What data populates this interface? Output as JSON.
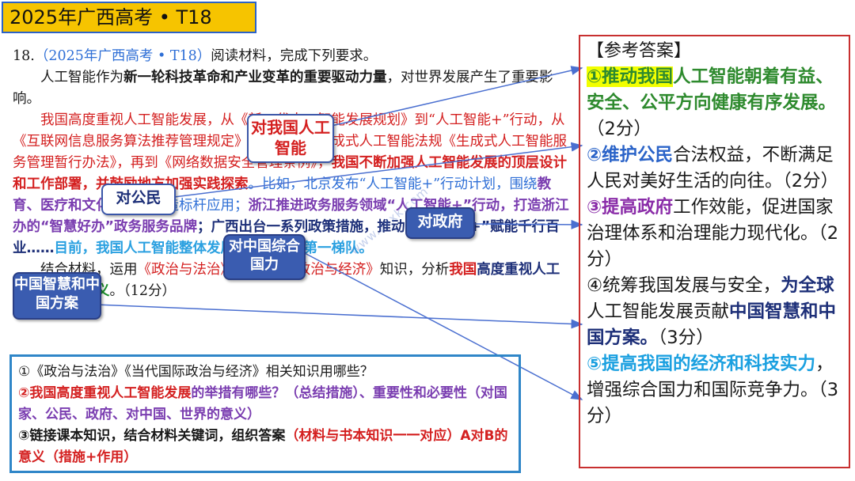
{
  "header": {
    "title": "2025年广西高考 • T18"
  },
  "material": {
    "q_number": "18.",
    "q_source": "（2025年广西高考 • T18）",
    "q_intro": "阅读材料，完成下列要求。",
    "p1_a": "人工智能作为",
    "p1_b": "新一轮科技革命和产业变革的重要驱动力量",
    "p1_c": "，对世界发展产生了重要影响。",
    "p2_a": "我国高度重视人工智能发展，从《新一代人工智能发展规划》到“人工智能+”行动，从《互联网信息服务算法推荐管理规定》到全球首部生成式人工智能法规《生成式人工智能服务管理暂行办法》，再到《网络数据安全管理条例》，",
    "p2_b": "我国不断加强人工智能发展的顶层设计和工作部署，并鼓励地方加强实践探索",
    "p2_c": "。比如，北京发布“人工智能+”行动计划，围绕",
    "p2_d": "教育、医疗和文化",
    "p2_e": "等领域打造标杆应用；",
    "p2_f": "浙江推进政务服务领域“人工智能+”行动，打造浙江办的“智慧好办”政务服务品牌",
    "p2_g": "；广西出台一系列政策措施，推动“人工智能+”赋能千行百业……",
    "p2_h": "目前，我国人工智能整体发展已进入全球第一梯队。",
    "p3_a": "结合材料，运用",
    "p3_b": "《政治与法治》《当代国际政治与经济》",
    "p3_c": "知识，分析",
    "p3_d": "我国",
    "p3_e": "高度重视人工智能发展",
    "p3_f": "的",
    "p3_g": "意义",
    "p3_h": "。（12分）"
  },
  "callouts": {
    "ai": "对我国人工智能",
    "citizen": "对公民",
    "government": "对政府",
    "national_power": "对中国综合国力",
    "china_wisdom": "中国智慧和中国方案"
  },
  "question_box": {
    "l1": "①《政治与法治》《当代国际政治与经济》相关知识用哪些？",
    "l2_a": "②我国高度重视人工智能发展",
    "l2_b": "的举措有哪些？（总结措施）、重要性和必要性",
    "l2_c": "（对国家、公民、政府、对中国、世界的意义）",
    "l3_a": "③链接课本知识，结合材料关键词，组织答案",
    "l3_b": "（材料与书本知识一一对应）A对B的意义（措施+作用）"
  },
  "answer": {
    "title": "【参考答案】",
    "a1_hl": "①推动我国",
    "a1_b": "人工智能朝着有益、安全、公平方向健康有序发展。",
    "a1_c": "（2分）",
    "a2_a": "②维护公民",
    "a2_b": "合法权益，不断满足人民对美好生活的向往。（2分）",
    "a3_a": "③提高政府",
    "a3_b": "工作效能，促进国家治理体系和治理能力现代化。（2分）",
    "a4_a": "④统筹我国发展与安全，",
    "a4_b": "为全球",
    "a4_c": "人工智能发展贡献",
    "a4_d": "中国智慧和中国方案。",
    "a4_e": "（3分）",
    "a5_a": "⑤提高我国的经济和科技实力",
    "a5_b": "，增强综合国力和国际竞争力。（3分）"
  },
  "colors": {
    "badge": "#f6c400",
    "answer_border": "#c83030",
    "question_border": "#2f86c8",
    "arrow": "#4a6fd0"
  }
}
